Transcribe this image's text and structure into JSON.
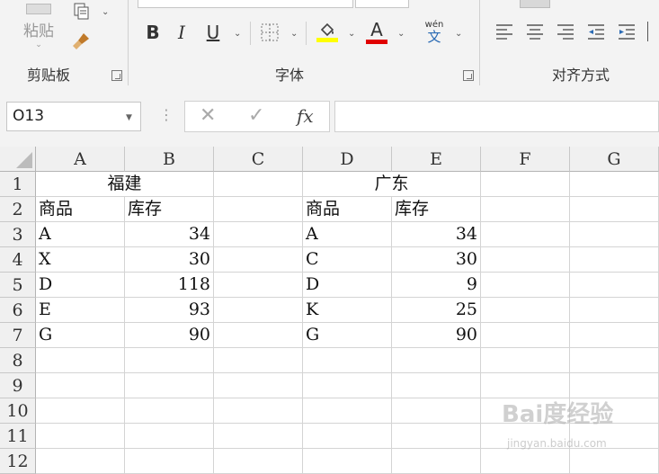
{
  "ribbon": {
    "clipboard": {
      "label": "剪贴板",
      "paste_label": "粘贴"
    },
    "font": {
      "label": "字体",
      "bold": "B",
      "italic": "I",
      "underline": "U",
      "font_color_glyph": "A",
      "phonetic_top": "wén",
      "phonetic_bottom": "文"
    },
    "alignment": {
      "label": "对齐方式"
    },
    "colors": {
      "fill_highlight": "#ffff00",
      "font_color": "#e00000"
    }
  },
  "formula_bar": {
    "name_box": "O13",
    "fx": "fx",
    "content": ""
  },
  "sheet": {
    "columns": [
      "A",
      "B",
      "C",
      "D",
      "E",
      "F",
      "G"
    ],
    "rows": [
      "1",
      "2",
      "3",
      "4",
      "5",
      "6",
      "7",
      "8",
      "9",
      "10",
      "11",
      "12"
    ],
    "fujian": {
      "title": "福建",
      "header": [
        "商品",
        "库存"
      ],
      "items": [
        [
          "A",
          "34"
        ],
        [
          "X",
          "30"
        ],
        [
          "D",
          "118"
        ],
        [
          "E",
          "93"
        ],
        [
          "G",
          "90"
        ]
      ]
    },
    "guangdong": {
      "title": "广东",
      "header": [
        "商品",
        "库存"
      ],
      "items": [
        [
          "A",
          "34"
        ],
        [
          "C",
          "30"
        ],
        [
          "D",
          "9"
        ],
        [
          "K",
          "25"
        ],
        [
          "G",
          "90"
        ]
      ]
    }
  },
  "watermark": {
    "brand": "Bai度经验",
    "url": "jingyan.baidu.com"
  }
}
